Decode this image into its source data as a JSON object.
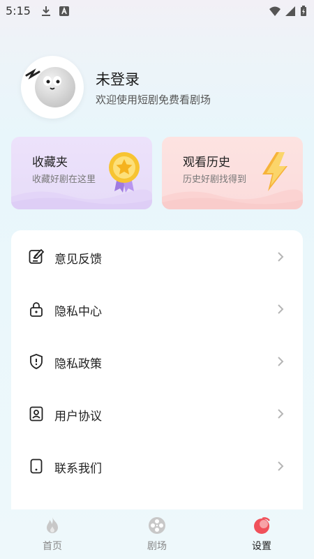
{
  "status_bar": {
    "time": "5:15"
  },
  "profile": {
    "name": "未登录",
    "subtitle": "欢迎使用短剧免费看剧场"
  },
  "cards": [
    {
      "title": "收藏夹",
      "desc": "收藏好剧在这里"
    },
    {
      "title": "观看历史",
      "desc": "历史好剧找得到"
    }
  ],
  "menu": [
    {
      "label": "意见反馈",
      "icon": "feedback-icon"
    },
    {
      "label": "隐私中心",
      "icon": "lock-icon"
    },
    {
      "label": "隐私政策",
      "icon": "shield-icon"
    },
    {
      "label": "用户协议",
      "icon": "user-document-icon"
    },
    {
      "label": "联系我们",
      "icon": "phone-icon"
    }
  ],
  "tabs": [
    {
      "label": "首页",
      "icon": "fire-icon"
    },
    {
      "label": "剧场",
      "icon": "film-reel-icon"
    },
    {
      "label": "设置",
      "icon": "settings-avatar-icon",
      "active": true
    }
  ],
  "colors": {
    "accent": "#f0515a",
    "tab_inactive": "#c8c8c8"
  }
}
